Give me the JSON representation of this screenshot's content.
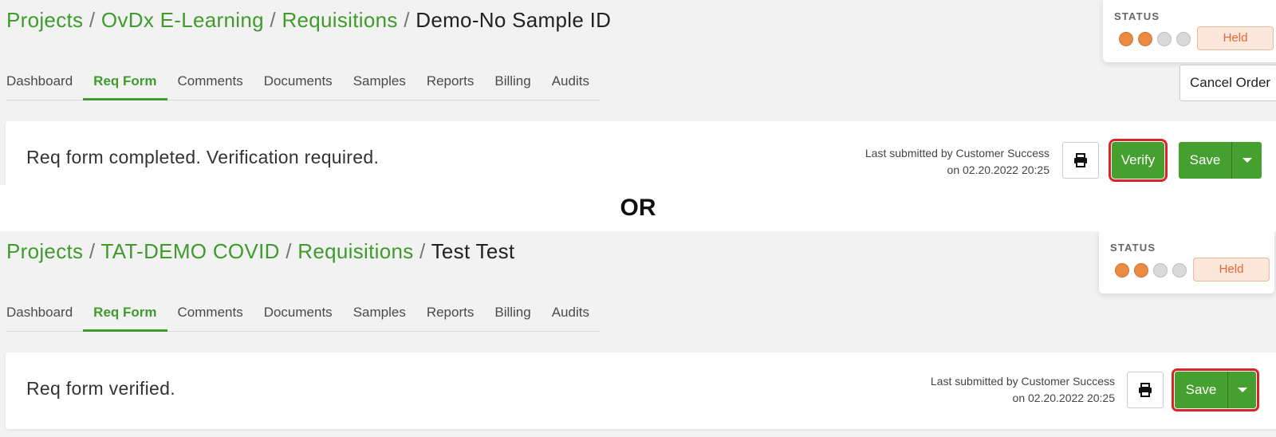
{
  "top": {
    "breadcrumb": {
      "projects": "Projects",
      "project": "OvDx E-Learning",
      "requisitions": "Requisitions",
      "current": "Demo-No Sample ID",
      "separator": "/"
    },
    "tabs": [
      "Dashboard",
      "Req Form",
      "Comments",
      "Documents",
      "Samples",
      "Reports",
      "Billing",
      "Audits"
    ],
    "active_tab": "Req Form",
    "status": {
      "label": "STATUS",
      "badge": "Held",
      "steps_done": 2,
      "steps_total": 4
    },
    "cancel_label": "Cancel Order",
    "message": "Req form completed. Verification required.",
    "submitted_line1": "Last submitted by Customer Success",
    "submitted_line2": "on 02.20.2022 20:25",
    "print_icon": "printer-icon",
    "verify_label": "Verify",
    "save_label": "Save",
    "dropdown_icon": "caret-down-icon"
  },
  "or_label": "OR",
  "bottom": {
    "breadcrumb": {
      "projects": "Projects",
      "project": "TAT-DEMO COVID",
      "requisitions": "Requisitions",
      "current": "Test Test",
      "separator": "/"
    },
    "tabs": [
      "Dashboard",
      "Req Form",
      "Comments",
      "Documents",
      "Samples",
      "Reports",
      "Billing",
      "Audits"
    ],
    "active_tab": "Req Form",
    "status": {
      "label": "STATUS",
      "badge": "Held",
      "steps_done": 2,
      "steps_total": 4
    },
    "message": "Req form verified.",
    "submitted_line1": "Last submitted by Customer Success",
    "submitted_line2": "on 02.20.2022 20:25",
    "print_icon": "printer-icon",
    "save_label": "Save",
    "dropdown_icon": "caret-down-icon"
  },
  "colors": {
    "brand_green": "#45a02f",
    "link_green": "#3f9b2c",
    "status_orange": "#e98b43",
    "held_badge_bg": "#fde6da",
    "highlight_red": "#d9252a"
  }
}
